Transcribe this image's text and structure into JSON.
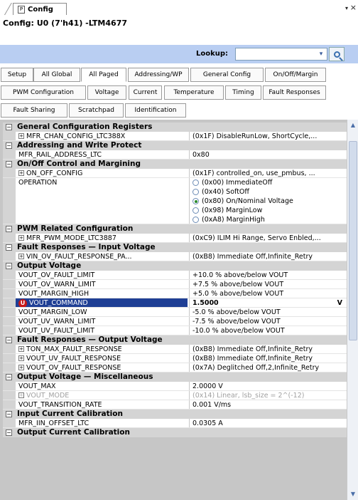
{
  "tab": {
    "icon": "P",
    "label": "Config",
    "pin": "▾",
    "close": "×"
  },
  "title": "Config: U0 (7'h41) -LTM4677",
  "lookup": {
    "label": "Lookup:",
    "value": "",
    "dropdown": "▾",
    "icon": "search-icon"
  },
  "tabs_row1": [
    "Setup",
    "All Global",
    "All Paged",
    "Addressing/WP",
    "General Config",
    "On/Off/Margin"
  ],
  "tabs_row2": [
    "PWM Configuration",
    "Voltage",
    "Current",
    "Temperature",
    "Timing",
    "Fault Responses"
  ],
  "tabs_row3": [
    "Fault Sharing",
    "Scratchpad",
    "Identification"
  ],
  "active_tab": "All Paged",
  "grid": {
    "rows": [
      {
        "kind": "cat",
        "label": "General Configuration Registers"
      },
      {
        "kind": "item",
        "expand": true,
        "name": "MFR_CHAN_CONFIG_LTC388X",
        "value": "(0x1F)  DisableRunLow, ShortCycle,..."
      },
      {
        "kind": "cat",
        "label": "Addressing and Write Protect"
      },
      {
        "kind": "item",
        "name": "MFR_RAIL_ADDRESS_LTC",
        "value": "0x80"
      },
      {
        "kind": "cat",
        "label": "On/Off Control and Margining"
      },
      {
        "kind": "item",
        "expand": true,
        "name": "ON_OFF_CONFIG",
        "value": "(0x1F)  controlled_on, use_pmbus, ..."
      },
      {
        "kind": "radio",
        "name": "OPERATION",
        "options": [
          {
            "label": "(0x00) ImmediateOff",
            "checked": false
          },
          {
            "label": "(0x40) SoftOff",
            "checked": false
          },
          {
            "label": "(0x80) On/Nominal Voltage",
            "checked": true
          },
          {
            "label": "(0x98) MarginLow",
            "checked": false
          },
          {
            "label": "(0xA8) MarginHigh",
            "checked": false
          }
        ]
      },
      {
        "kind": "cat",
        "label": "PWM Related Configuration"
      },
      {
        "kind": "item",
        "expand": true,
        "name": "MFR_PWM_MODE_LTC3887",
        "value": "(0xC9) ILIM Hi Range, Servo Enbled,..."
      },
      {
        "kind": "cat",
        "label": "Fault Responses — Input Voltage"
      },
      {
        "kind": "item",
        "expand": true,
        "name": "VIN_OV_FAULT_RESPONSE_PA...",
        "value": "(0xB8) Immediate Off,Infinite_Retry"
      },
      {
        "kind": "cat",
        "label": "Output Voltage"
      },
      {
        "kind": "item",
        "name": "VOUT_OV_FAULT_LIMIT",
        "value": "+10.0 % above/below VOUT"
      },
      {
        "kind": "item",
        "name": "VOUT_OV_WARN_LIMIT",
        "value": "+7.5 % above/below VOUT"
      },
      {
        "kind": "item",
        "name": "VOUT_MARGIN_HIGH",
        "value": "+5.0 % above/below VOUT"
      },
      {
        "kind": "item",
        "selected": true,
        "badge": "U",
        "name": "VOUT_COMMAND",
        "value": "1.5000",
        "dropdown": "V"
      },
      {
        "kind": "item",
        "name": "VOUT_MARGIN_LOW",
        "value": "-5.0 % above/below VOUT"
      },
      {
        "kind": "item",
        "name": "VOUT_UV_WARN_LIMIT",
        "value": "-7.5 % above/below VOUT"
      },
      {
        "kind": "item",
        "name": "VOUT_UV_FAULT_LIMIT",
        "value": "-10.0 % above/below VOUT"
      },
      {
        "kind": "cat",
        "label": "Fault Responses — Output Voltage"
      },
      {
        "kind": "item",
        "expand": true,
        "name": "TON_MAX_FAULT_RESPONSE",
        "value": "(0xB8) Immediate Off,Infinite_Retry"
      },
      {
        "kind": "item",
        "expand": true,
        "name": "VOUT_UV_FAULT_RESPONSE",
        "value": "(0xB8) Immediate Off,Infinite_Retry"
      },
      {
        "kind": "item",
        "expand": true,
        "name": "VOUT_OV_FAULT_RESPONSE",
        "value": "(0x7A) Deglitched Off,2,Infinite_Retry"
      },
      {
        "kind": "cat",
        "label": "Output Voltage — Miscellaneous"
      },
      {
        "kind": "item",
        "name": "VOUT_MAX",
        "value": "2.0000 V"
      },
      {
        "kind": "item",
        "expand": true,
        "grey": true,
        "name": "VOUT_MODE",
        "value": "(0x14) Linear, lsb_size = 2^(-12)"
      },
      {
        "kind": "item",
        "name": "VOUT_TRANSITION_RATE",
        "value": "0.001 V/ms"
      },
      {
        "kind": "cat",
        "label": "Input Current Calibration"
      },
      {
        "kind": "item",
        "name": "MFR_IIN_OFFSET_LTC",
        "value": "0.0305 A"
      },
      {
        "kind": "cat",
        "label": "Output Current Calibration"
      }
    ]
  },
  "scroll": {
    "up": "▲",
    "down": "▼"
  },
  "colors": {
    "lookup_bar": "#b9cef2",
    "selected_row": "#1f3f95",
    "category_row": "#d4d4d4",
    "badge": "#c81818"
  }
}
